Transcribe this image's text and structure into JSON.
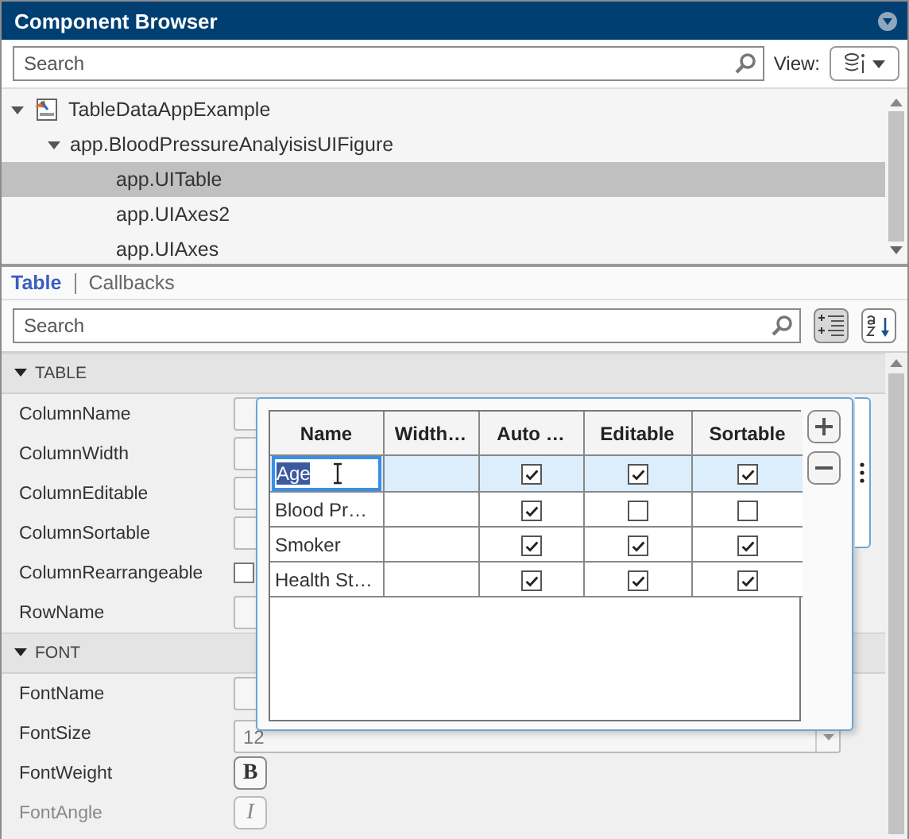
{
  "window": {
    "title": "Component Browser"
  },
  "component_search": {
    "placeholder": "Search"
  },
  "view": {
    "label": "View:"
  },
  "tree": [
    {
      "label": "TableDataAppExample",
      "expanded": true,
      "selected": false,
      "children": [
        {
          "label": "app.BloodPressureAnalyisisUIFigure",
          "expanded": true,
          "selected": false,
          "children": [
            {
              "label": "app.UITable",
              "selected": true
            },
            {
              "label": "app.UIAxes2",
              "selected": false
            },
            {
              "label": "app.UIAxes",
              "selected": false
            }
          ]
        }
      ]
    }
  ],
  "inspector_tabs": [
    {
      "label": "Table",
      "selected": true
    },
    {
      "label": "Callbacks",
      "selected": false
    }
  ],
  "property_search": {
    "placeholder": "Search"
  },
  "sections": [
    {
      "title": "TABLE",
      "expanded": true,
      "properties": [
        {
          "name": "ColumnName",
          "kind": "text"
        },
        {
          "name": "ColumnWidth",
          "kind": "text"
        },
        {
          "name": "ColumnEditable",
          "kind": "text"
        },
        {
          "name": "ColumnSortable",
          "kind": "text"
        },
        {
          "name": "ColumnRearrangeable",
          "kind": "checkbox",
          "checked": false
        },
        {
          "name": "RowName",
          "kind": "text"
        }
      ]
    },
    {
      "title": "FONT",
      "expanded": true,
      "properties": [
        {
          "name": "FontName",
          "kind": "text"
        },
        {
          "name": "FontSize",
          "kind": "dropdown",
          "value": "12"
        },
        {
          "name": "FontWeight",
          "kind": "button",
          "value": "B"
        },
        {
          "name": "FontAngle",
          "kind": "button",
          "value": "I"
        }
      ]
    }
  ],
  "popup_table": {
    "columns": [
      "Name",
      "Width…",
      "Auto …",
      "Editable",
      "Sortable"
    ],
    "rows": [
      {
        "name": "Age",
        "selected": true,
        "editing": true,
        "auto_width": true,
        "editable": true,
        "sortable": true
      },
      {
        "name": "Blood Pr…",
        "selected": false,
        "editing": false,
        "auto_width": true,
        "editable": false,
        "sortable": false
      },
      {
        "name": "Smoker",
        "selected": false,
        "editing": false,
        "auto_width": true,
        "editable": true,
        "sortable": true
      },
      {
        "name": "Health St…",
        "selected": false,
        "editing": false,
        "auto_width": true,
        "editable": true,
        "sortable": true
      }
    ]
  }
}
